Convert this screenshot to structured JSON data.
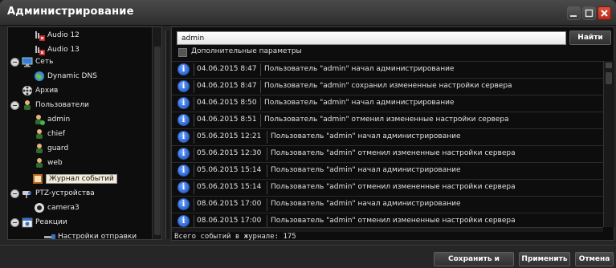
{
  "window": {
    "title": "Администрирование"
  },
  "tree": [
    {
      "label": "Audio 12"
    },
    {
      "label": "Audio 13"
    },
    {
      "label": "Сеть"
    },
    {
      "label": "Dynamic DNS"
    },
    {
      "label": "Архив"
    },
    {
      "label": "Пользователи"
    },
    {
      "label": "admin"
    },
    {
      "label": "chief"
    },
    {
      "label": "guard"
    },
    {
      "label": "web"
    },
    {
      "label": "Журнал событий"
    },
    {
      "label": "PTZ-устройства"
    },
    {
      "label": "camera3"
    },
    {
      "label": "Реакции"
    },
    {
      "label": "Настройки отправки"
    }
  ],
  "search": {
    "value": "admin",
    "find_label": "Найти"
  },
  "options": {
    "extra_params_label": "Дополнительные параметры",
    "extra_params_checked": false
  },
  "log": {
    "rows": [
      {
        "date": "04.06.2015 8:47",
        "message": "Пользователь \"admin\" начал администрирование"
      },
      {
        "date": "04.06.2015 8:47",
        "message": "Пользователь \"admin\" сохранил измененные настройки сервера"
      },
      {
        "date": "04.06.2015 8:50",
        "message": "Пользователь \"admin\" начал администрирование"
      },
      {
        "date": "04.06.2015 8:51",
        "message": "Пользователь \"admin\" отменил измененные настройки сервера"
      },
      {
        "date": "05.06.2015 12:21",
        "message": "Пользователь \"admin\" начал администрирование"
      },
      {
        "date": "05.06.2015 12:30",
        "message": "Пользователь \"admin\" отменил измененные настройки сервера"
      },
      {
        "date": "05.06.2015 15:14",
        "message": "Пользователь \"admin\" начал администрирование"
      },
      {
        "date": "05.06.2015 15:14",
        "message": "Пользователь \"admin\" отменил измененные настройки сервера"
      },
      {
        "date": "08.06.2015 17:00",
        "message": "Пользователь \"admin\" начал администрирование"
      },
      {
        "date": "08.06.2015 17:00",
        "message": "Пользователь \"admin\" отменил измененные настройки сервера"
      }
    ],
    "total_label": "Всего событий в журнале: 175"
  },
  "footer": {
    "save_exit_label": "Сохранить и выйти",
    "apply_label": "Применить",
    "cancel_label": "Отмена"
  },
  "colors": {
    "close": "#c9371f",
    "info_icon": "#2b63d9",
    "selection": "#f2ecd8"
  }
}
